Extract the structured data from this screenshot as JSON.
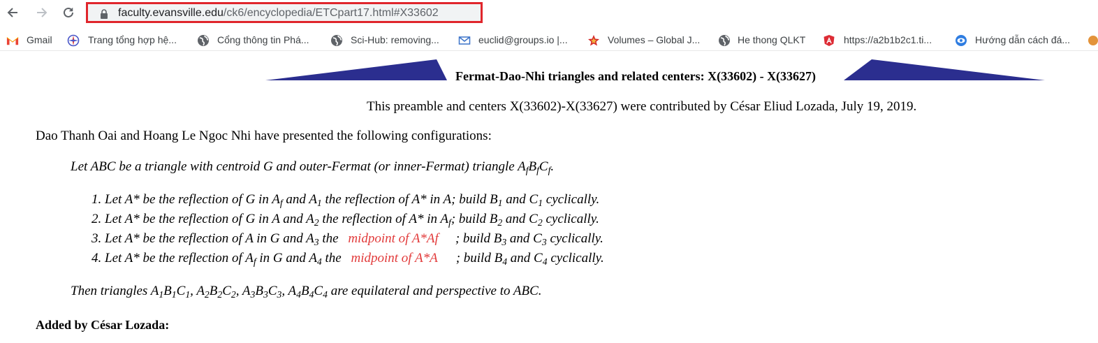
{
  "browser": {
    "url_host": "faculty.evansville.edu",
    "url_path": "/ck6/encyclopedia/ETCpart17.html#X33602"
  },
  "bookmarks": [
    {
      "label": "Gmail",
      "icon": "gmail-icon"
    },
    {
      "label": "Trang tổng hợp hệ...",
      "icon": "compass-icon"
    },
    {
      "label": "Cổng thông tin Phá...",
      "icon": "globe-icon"
    },
    {
      "label": "Sci-Hub: removing...",
      "icon": "globe-icon"
    },
    {
      "label": "euclid@groups.io |...",
      "icon": "mail-icon"
    },
    {
      "label": "Volumes – Global J...",
      "icon": "star-icon"
    },
    {
      "label": "He thong QLKT",
      "icon": "globe-icon"
    },
    {
      "label": "https://a2b1b2c1.ti...",
      "icon": "angular-icon"
    },
    {
      "label": "Hướng dẫn cách đá...",
      "icon": "eye-icon"
    }
  ],
  "page": {
    "title": "Fermat-Dao-Nhi triangles and related centers: X(33602) - X(33627)",
    "preamble": "This preamble and centers X(33602)-X(33627) were contributed by César Eliud Lozada, July 19, 2019.",
    "intro": "Dao Thanh Oai and Hoang Le Ngoc Nhi have presented the following configurations:",
    "let_text": "Let ABC be a triangle with centroid G and outer-Fermat (or inner-Fermat) triangle A",
    "items": {
      "n1": "1.",
      "n2": "2.",
      "n3": "3.",
      "n4": "4."
    },
    "link1": "midpoint of A*Af",
    "link2": "midpoint of A*A",
    "then_text": "are equilateral and perspective to ABC.",
    "added_by": "Added by César Lozada:"
  },
  "colors": {
    "link": "#e23b3b",
    "banner": "#2b2e8f",
    "highlight_box": "#e0262c"
  }
}
